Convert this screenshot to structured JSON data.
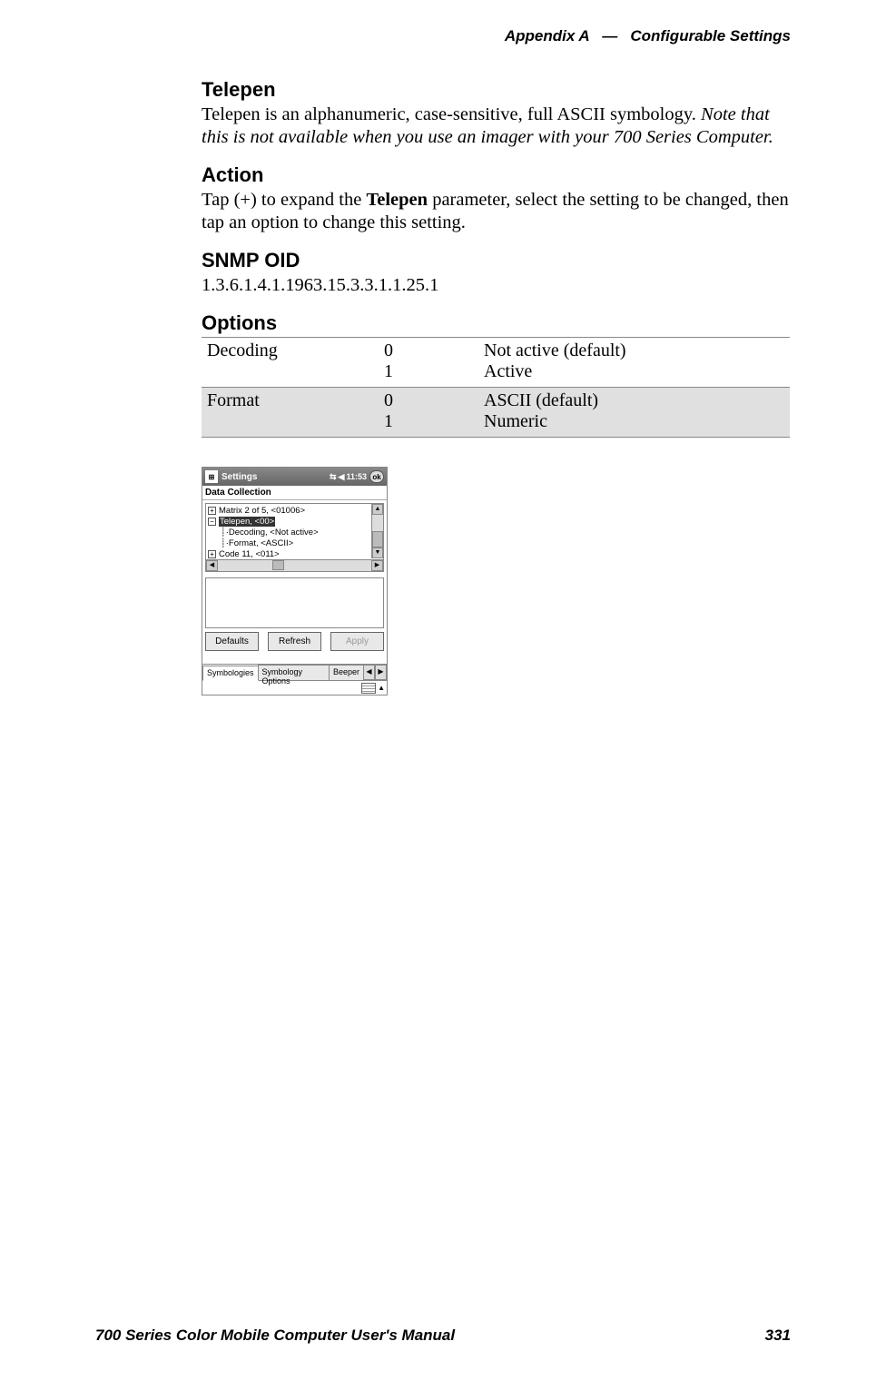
{
  "header": {
    "appendix": "Appendix A",
    "sep": "—",
    "section": "Configurable Settings"
  },
  "telepen": {
    "title": "Telepen",
    "desc_plain": "Telepen is an alphanumeric, case-sensitive, full ASCII symbology. ",
    "desc_italic": "Note that this is not available when you use an imager with your 700 Series Computer."
  },
  "action": {
    "title": "Action",
    "pre": "Tap (+) to expand the ",
    "bold": "Telepen",
    "post": " parameter, select the setting to be changed, then tap an option to change this setting."
  },
  "snmp": {
    "title": "SNMP OID",
    "oid": "1.3.6.1.4.1.1963.15.3.3.1.1.25.1"
  },
  "options": {
    "title": "Options",
    "rows": [
      {
        "name": "Decoding",
        "values": "0\n1",
        "meanings": "Not active (default)\nActive"
      },
      {
        "name": "Format",
        "values": "0\n1",
        "meanings": "ASCII (default)\nNumeric"
      }
    ]
  },
  "screenshot": {
    "titlebar": "Settings",
    "time": "11:53",
    "ok": "ok",
    "subtitle": "Data Collection",
    "tree": {
      "item0": "Matrix 2 of 5, <01006>",
      "item1": "Telepen, <00>",
      "item1a": "Decoding, <Not active>",
      "item1b": "Format, <ASCII>",
      "item2": "Code 11, <011>"
    },
    "buttons": {
      "defaults": "Defaults",
      "refresh": "Refresh",
      "apply": "Apply"
    },
    "tabs": {
      "t1": "Symbologies",
      "t2": "Symbology Options",
      "t3": "Beeper"
    }
  },
  "footer": {
    "manual": "700 Series Color Mobile Computer User's Manual",
    "page": "331"
  }
}
